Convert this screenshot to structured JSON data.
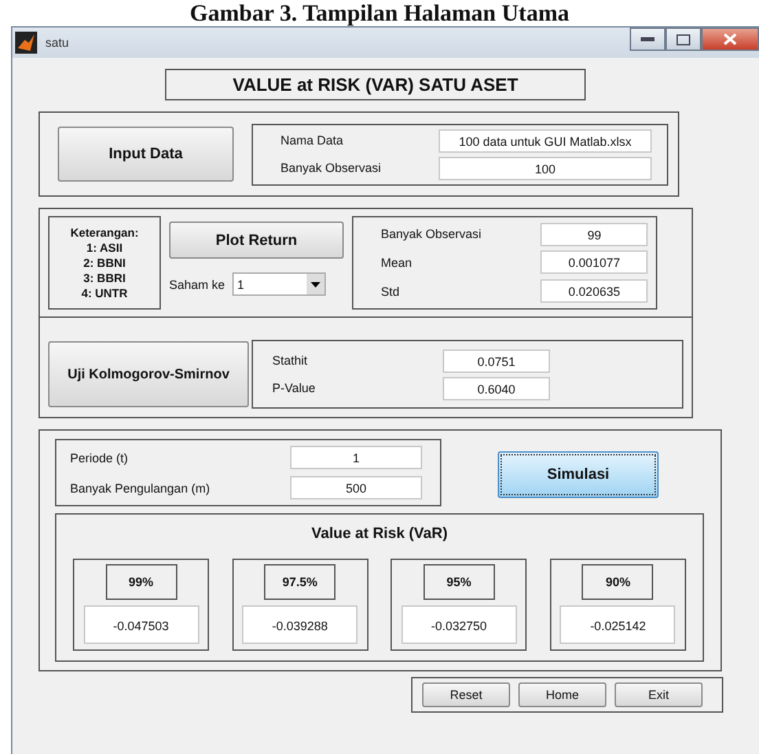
{
  "caption": "Gambar 3. Tampilan Halaman Utama",
  "window": {
    "title": "satu"
  },
  "heading": "VALUE at RISK (VAR) SATU ASET",
  "input": {
    "button": "Input Data",
    "fields": [
      {
        "label": "Nama Data",
        "value": "100 data untuk GUI Matlab.xlsx"
      },
      {
        "label": "Banyak Observasi",
        "value": "100"
      }
    ]
  },
  "returns": {
    "legend": [
      "Keterangan:",
      "1: ASII",
      "2: BBNI",
      "3: BBRI",
      "4: UNTR"
    ],
    "button": "Plot Return",
    "select_label": "Saham ke",
    "select_value": "1",
    "stats": [
      {
        "label": "Banyak Observasi",
        "value": "99"
      },
      {
        "label": "Mean",
        "value": "0.001077"
      },
      {
        "label": "Std",
        "value": "0.020635"
      }
    ]
  },
  "ks": {
    "button": "Uji Kolmogorov-Smirnov",
    "stats": [
      {
        "label": "Stathit",
        "value": "0.0751"
      },
      {
        "label": "P-Value",
        "value": "0.6040"
      }
    ]
  },
  "simulation": {
    "fields": [
      {
        "label": "Periode (t)",
        "value": "1"
      },
      {
        "label": "Banyak Pengulangan (m)",
        "value": "500"
      }
    ],
    "button": "Simulasi",
    "focused": true
  },
  "var": {
    "title": "Value at Risk (VaR)",
    "items": [
      {
        "confidence": "99%",
        "value": "-0.047503"
      },
      {
        "confidence": "97.5%",
        "value": "-0.039288"
      },
      {
        "confidence": "95%",
        "value": "-0.032750"
      },
      {
        "confidence": "90%",
        "value": "-0.025142"
      }
    ]
  },
  "footer_buttons": [
    "Reset",
    "Home",
    "Exit"
  ]
}
